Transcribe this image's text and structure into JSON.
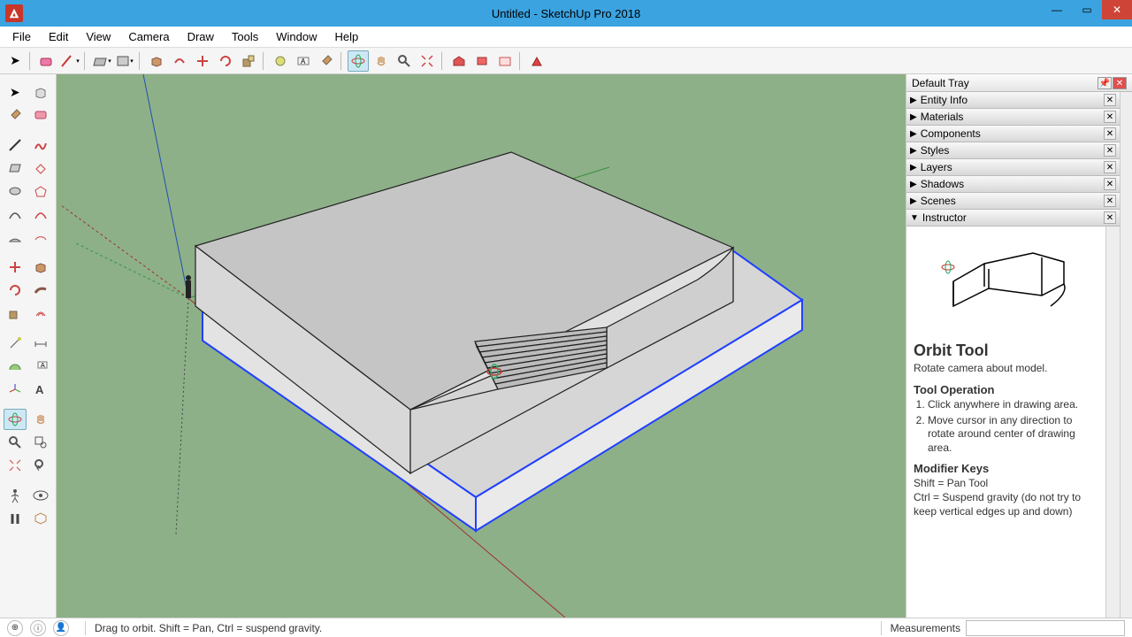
{
  "window": {
    "title": "Untitled - SketchUp Pro 2018"
  },
  "menu": [
    "File",
    "Edit",
    "View",
    "Camera",
    "Draw",
    "Tools",
    "Window",
    "Help"
  ],
  "tray": {
    "title": "Default Tray",
    "panels": [
      "Entity Info",
      "Materials",
      "Components",
      "Styles",
      "Layers",
      "Shadows",
      "Scenes",
      "Instructor"
    ]
  },
  "instructor": {
    "tool_name": "Orbit Tool",
    "subtitle": "Rotate camera about model.",
    "operation_heading": "Tool Operation",
    "operation_steps": [
      "Click anywhere in drawing area.",
      "Move cursor in any direction to rotate around center of drawing area."
    ],
    "modifier_heading": "Modifier Keys",
    "modifier1": "Shift = Pan Tool",
    "modifier2": "Ctrl = Suspend gravity (do not try to keep vertical edges up and down)"
  },
  "status": {
    "hint": "Drag to orbit. Shift = Pan, Ctrl = suspend gravity.",
    "measurements_label": "Measurements"
  }
}
